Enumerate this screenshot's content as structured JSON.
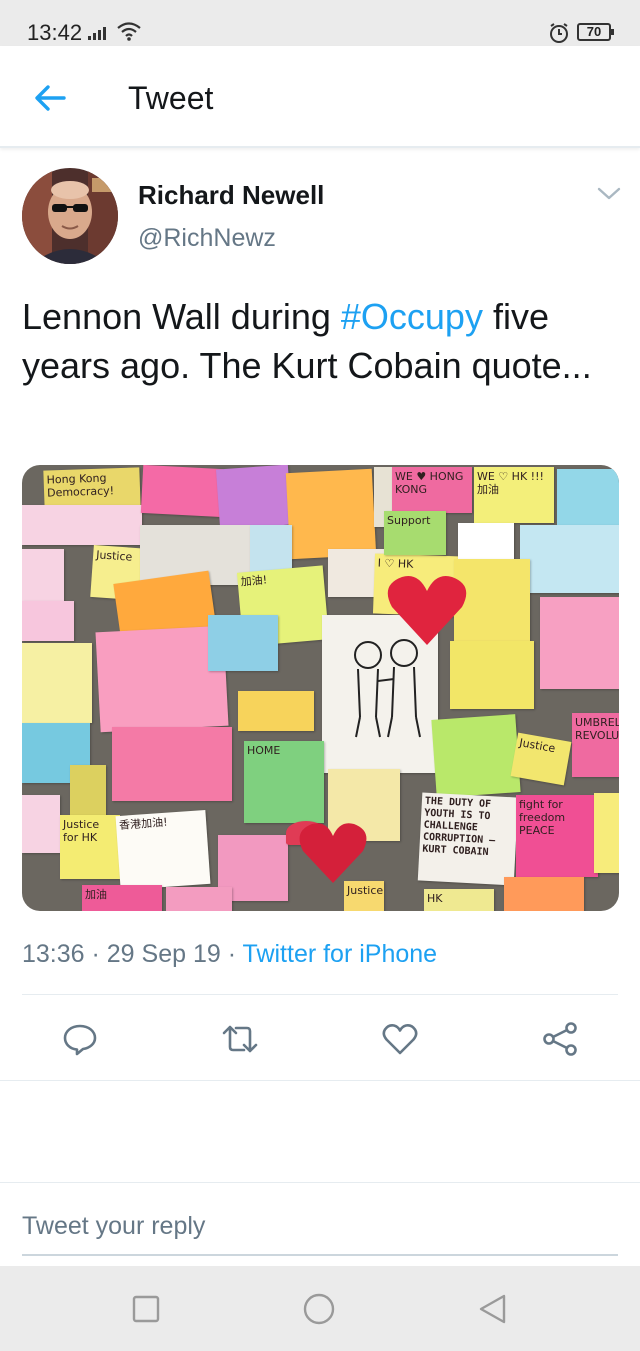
{
  "status_bar": {
    "time": "13:42",
    "battery": "70"
  },
  "header": {
    "title": "Tweet"
  },
  "tweet": {
    "display_name": "Richard Newell",
    "handle": "@RichNewz",
    "text_part1": "Lennon Wall during ",
    "hashtag": "#Occupy",
    "text_part2": " five years ago. The Kurt Cobain quote...",
    "timestamp": "13:36 · 29 Sep 19 · ",
    "source": "Twitter for iPhone"
  },
  "media": {
    "notes": [
      {
        "text": "Hong Kong Democracy!",
        "color": "#e9d76a"
      },
      {
        "text": "WE ♥ HONG KONG",
        "color": "#ef6aa0"
      },
      {
        "text": "WE ♡ HK !!! 加油",
        "color": "#f3ef7a"
      },
      {
        "text": "Justice",
        "color": "#f6ee8e"
      },
      {
        "text": "I ♡ HK",
        "color": "#f7ec7b"
      },
      {
        "text": "加油!",
        "color": "#e6f27a"
      },
      {
        "text": "HOME",
        "color": "#7fd07f"
      },
      {
        "text": "UMBRELLA REVOLUTION",
        "color": "#ef6aa0"
      },
      {
        "text": "Justice",
        "color": "#f2e66e"
      },
      {
        "text": "THE DUTY OF YOUTH IS TO CHALLENGE CORRUPTION — KURT COBAIN",
        "color": "#f3f0ea"
      },
      {
        "text": "fight for freedom PEACE",
        "color": "#f04f94"
      },
      {
        "text": "香港加油!",
        "color": "#fdfbf6"
      },
      {
        "text": "Justice for HK",
        "color": "#f4ec72"
      },
      {
        "text": "加油",
        "color": "#ee5b98"
      },
      {
        "text": "HK",
        "color": "#efe991"
      },
      {
        "text": "Justice",
        "color": "#f7d96f"
      },
      {
        "text": "Support",
        "color": "#a7dc6f"
      }
    ]
  },
  "reply": {
    "placeholder": "Tweet your reply"
  },
  "icons": {
    "back": "arrow-left-icon",
    "chevron": "chevron-down-icon",
    "reply": "comment-icon",
    "retweet": "retweet-icon",
    "like": "heart-icon",
    "share": "share-icon"
  },
  "colors": {
    "accent": "#1da1f2",
    "secondary_text": "#657786",
    "icon_gray": "#657786"
  }
}
